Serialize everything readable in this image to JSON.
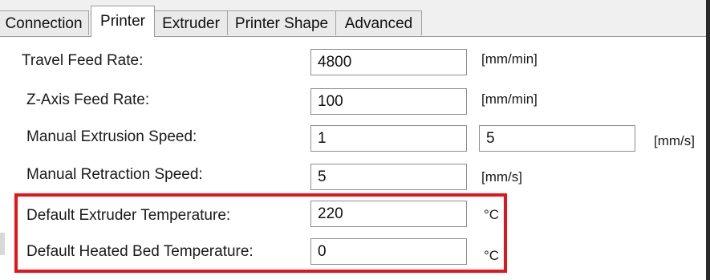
{
  "tabs": [
    {
      "label": "Connection",
      "active": false
    },
    {
      "label": "Printer",
      "active": true
    },
    {
      "label": "Extruder",
      "active": false
    },
    {
      "label": "Printer Shape",
      "active": false
    },
    {
      "label": "Advanced",
      "active": false
    }
  ],
  "settings": {
    "travel_feed_rate": {
      "label": "Travel Feed Rate:",
      "value": "4800",
      "unit": "[mm/min]"
    },
    "z_axis_feed_rate": {
      "label": "Z-Axis Feed Rate:",
      "value": "100",
      "unit": "[mm/min]"
    },
    "manual_extrusion_speed": {
      "label": "Manual Extrusion Speed:",
      "value1": "1",
      "value2": "5",
      "unit": "[mm/s]"
    },
    "manual_retraction_speed": {
      "label": "Manual Retraction Speed:",
      "value": "5",
      "unit": "[mm/s]"
    },
    "default_extruder_temperature": {
      "label": "Default Extruder Temperature:",
      "value": "220",
      "unit": "°C"
    },
    "default_heated_bed_temperature": {
      "label": "Default Heated Bed Temperature:",
      "value": "0",
      "unit": "°C"
    }
  },
  "colors": {
    "highlight_border": "#e8121a"
  }
}
